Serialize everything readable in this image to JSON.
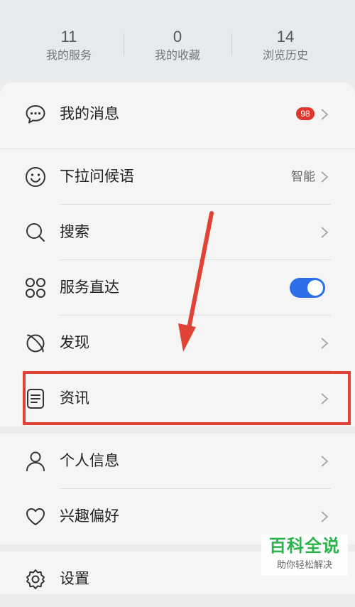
{
  "stats": [
    {
      "value": "11",
      "label": "我的服务"
    },
    {
      "value": "0",
      "label": "我的收藏"
    },
    {
      "value": "14",
      "label": "浏览历史"
    }
  ],
  "menu": {
    "messages": {
      "label": "我的消息",
      "badge": "98",
      "icon": "chat-bubble-icon"
    },
    "greeting": {
      "label": "下拉问候语",
      "value": "智能",
      "icon": "smiley-icon"
    },
    "search": {
      "label": "搜索",
      "icon": "search-icon"
    },
    "services": {
      "label": "服务直达",
      "toggle_on": true,
      "icon": "grid-circles-icon"
    },
    "discover": {
      "label": "发现",
      "icon": "planet-icon"
    },
    "news": {
      "label": "资讯",
      "icon": "document-icon"
    },
    "profile": {
      "label": "个人信息",
      "icon": "person-icon"
    },
    "interests": {
      "label": "兴趣偏好",
      "icon": "heart-icon"
    },
    "settings": {
      "label": "设置",
      "icon": "gear-icon"
    }
  },
  "colors": {
    "accent": "#2d6fe8",
    "badge": "#e0362d",
    "annotation": "#e04335",
    "watermark": "#29b34a"
  },
  "watermark": {
    "title": "百科全说",
    "subtitle": "助你轻松解决"
  }
}
